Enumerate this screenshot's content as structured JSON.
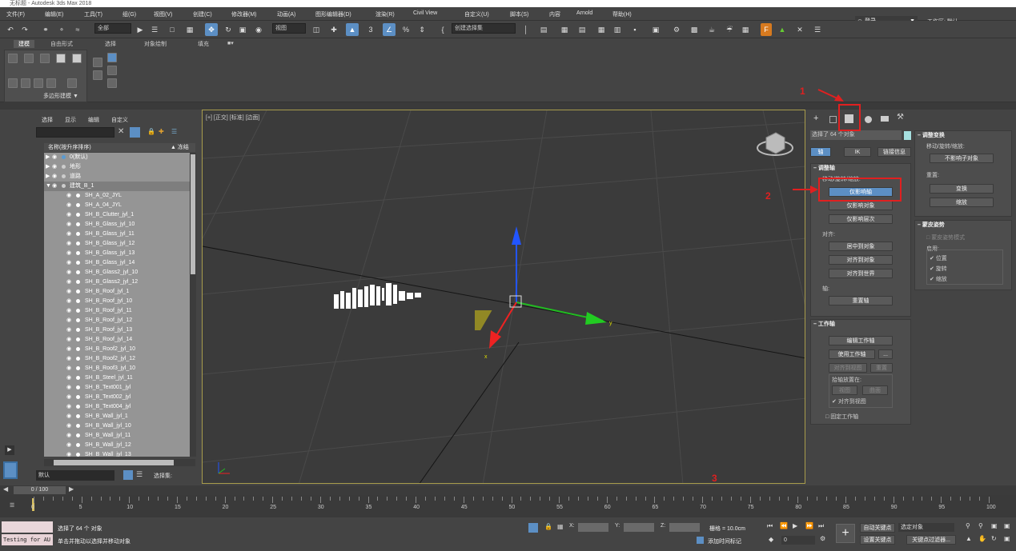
{
  "title": "无标题 - Autodesk 3ds Max 2018",
  "menu": [
    "文件(F)",
    "编辑(E)",
    "工具(T)",
    "组(G)",
    "视图(V)",
    "创建(C)",
    "修改器(M)",
    "动画(A)",
    "图形编辑器(D)",
    "渲染(R)",
    "Civil View",
    "自定义(U)",
    "脚本(S)",
    "内容",
    "Arnold",
    "帮助(H)"
  ],
  "signin": "登录",
  "workspace": "工作区: 默认",
  "toolbar": {
    "filter_all": "全部",
    "view_dropdown": "视图",
    "selection_set": "创建选择集"
  },
  "ribbon": {
    "tabs": [
      "建模",
      "自由形式",
      "选择",
      "对象绘制",
      "填充"
    ],
    "active_tab": "建模",
    "poly_label": "多边形建模 ▼"
  },
  "explorer": {
    "tabs": [
      "选择",
      "显示",
      "编辑",
      "自定义"
    ],
    "header_name": "名称(按升序排序)",
    "header_freeze": "▲ 冻结",
    "groups": [
      {
        "label": "0(默认)",
        "indent": 0
      },
      {
        "label": "地形",
        "indent": 0
      },
      {
        "label": "道路",
        "indent": 0
      },
      {
        "label": "建筑_B_1",
        "indent": 0,
        "selected": true
      }
    ],
    "items": [
      "SH_A_02_JYL",
      "SH_A_04_JYL",
      "SH_B_Clutter_jyl_1",
      "SH_B_Glass_jyl_10",
      "SH_B_Glass_jyl_11",
      "SH_B_Glass_jyl_12",
      "SH_B_Glass_jyl_13",
      "SH_B_Glass_jyl_14",
      "SH_B_Glass2_jyl_10",
      "SH_B_Glass2_jyl_12",
      "SH_B_Roof_jyl_1",
      "SH_B_Roof_jyl_10",
      "SH_B_Roof_jyl_11",
      "SH_B_Roof_jyl_12",
      "SH_B_Roof_jyl_13",
      "SH_B_Roof_jyl_14",
      "SH_B_Roof2_jyl_10",
      "SH_B_Roof2_jyl_12",
      "SH_B_Roof3_jyl_10",
      "SH_B_Steel_jyl_11",
      "SH_B_Text001_jyl",
      "SH_B_Text002_jyl",
      "SH_B_Text004_jyl",
      "SH_B_Wall_jyl_1",
      "SH_B_Wall_jyl_10",
      "SH_B_Wall_jyl_11",
      "SH_B_Wall_jyl_12",
      "SH_B_Wall_jyl_13"
    ],
    "footer_dropdown": "默认",
    "footer_set": "选择集:"
  },
  "viewport": {
    "label": "[+] [正交] [标准] [边面]",
    "axis_x": "x",
    "axis_y": "y"
  },
  "command": {
    "selected": "选择了 64 个对象",
    "tabs": [
      "轴",
      "IK",
      "链接信息"
    ],
    "adjust_pivot": {
      "title": "调整轴",
      "move_rotate_scale": "移动/旋转/缩放:",
      "buttons": [
        "仅影响轴",
        "仅影响对象",
        "仅影响层次"
      ],
      "align_label": "对齐:",
      "align_buttons": [
        "居中到对象",
        "对齐到对象",
        "对齐到世界"
      ],
      "pivot_label": "轴:",
      "reset_pivot": "重置轴"
    },
    "working_pivot": {
      "title": "工作轴",
      "edit": "编辑工作轴",
      "use": "使用工作轴",
      "ellipsis": "...",
      "align_view": "对齐到视图",
      "reset": "重置",
      "place_label": "拾轴放置在:",
      "view": "视图",
      "surface": "曲面",
      "align_view_check": "对齐到视图",
      "lock": "固定工作轴"
    },
    "adjust_transform": {
      "title": "调整变换",
      "move_label": "移动/旋转/缩放:",
      "dont_affect": "不影响子对象",
      "reset_label": "重置:",
      "transform": "变换",
      "scale": "缩放"
    },
    "skin_pose": {
      "title": "蒙皮姿势",
      "mode": "蒙皮姿势模式",
      "enable": "启用:",
      "position": "位置",
      "rotation": "旋转",
      "scale": "缩放"
    }
  },
  "annotations": [
    "1",
    "2",
    "3"
  ],
  "timeline": {
    "slider": "0 / 100",
    "ticks": [
      "0",
      "5",
      "10",
      "15",
      "20",
      "25",
      "30",
      "35",
      "40",
      "45",
      "50",
      "55",
      "60",
      "65",
      "70",
      "75",
      "80",
      "85",
      "90",
      "95",
      "100"
    ]
  },
  "status": {
    "maxscript": "",
    "maxscript_input": "Testing for AU",
    "line1": "选择了 64 个 对象",
    "line2": "单击并拖动以选择并移动对象",
    "x_label": "X:",
    "y_label": "Y:",
    "z_label": "Z:",
    "grid": "栅格 = 10.0cm",
    "add_time_tag": "添加时间标记",
    "auto_key": "自动关键点",
    "set_key": "设置关键点",
    "selected_obj": "选定对象",
    "key_filters": "关键点过滤器...",
    "frame": "0"
  },
  "colors": {
    "accent": "#5c8fc4",
    "annotation": "#e02020",
    "viewport_border": "#a89c4c"
  }
}
